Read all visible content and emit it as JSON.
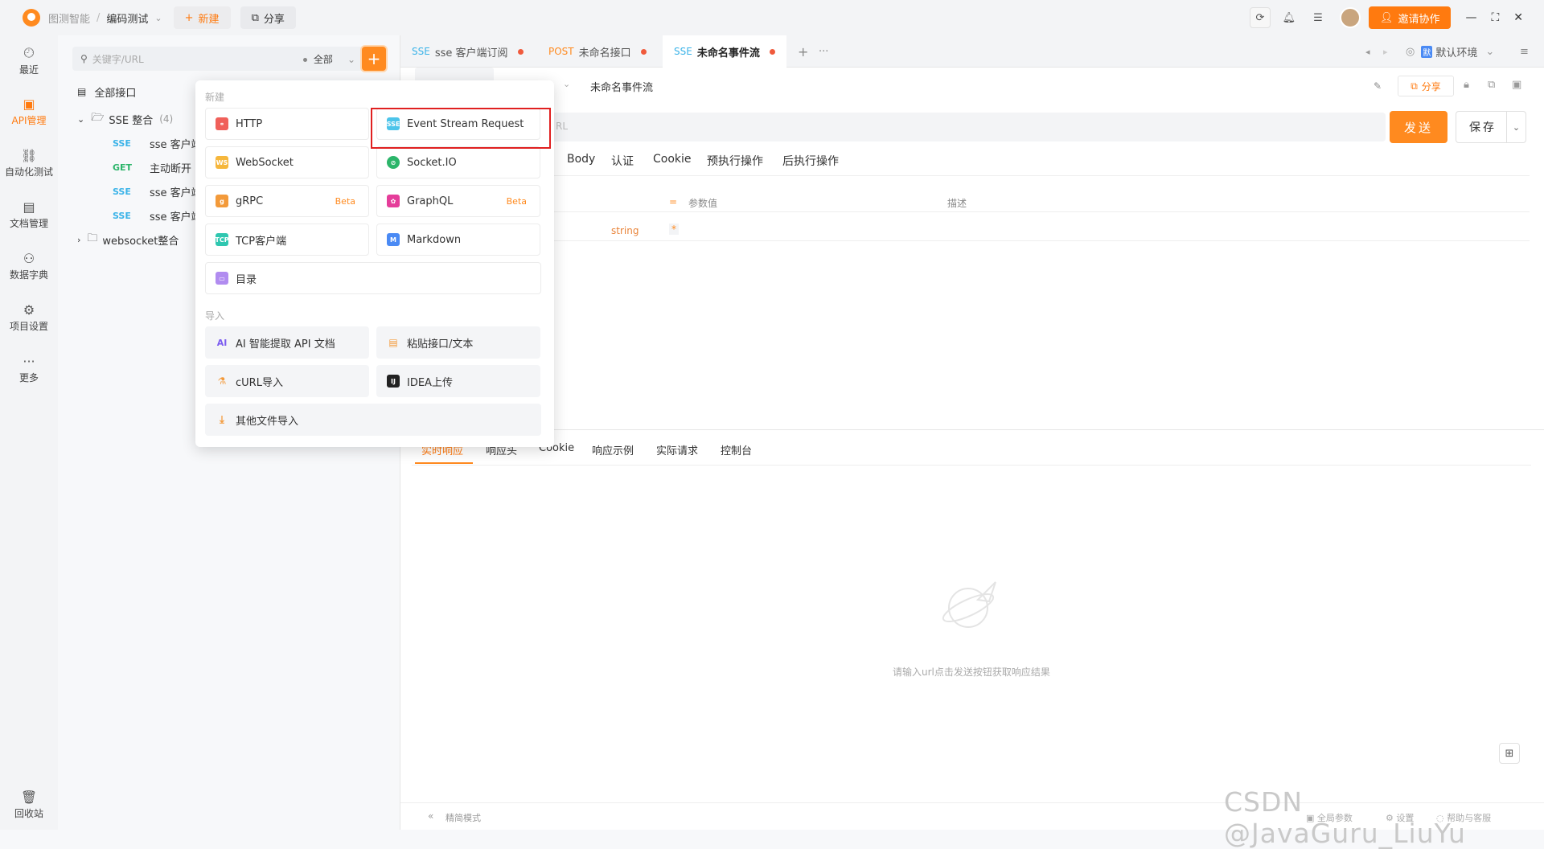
{
  "topbar": {
    "crumb_team": "图测智能",
    "crumb_sep": "/",
    "crumb_project": "编码测试",
    "new_label": "新建",
    "share_label": "分享",
    "invite_label": "邀请协作"
  },
  "nav": {
    "recent": "最近",
    "api": "API管理",
    "auto": "自动化测试",
    "docs": "文档管理",
    "dict": "数据字典",
    "settings": "项目设置",
    "more": "更多",
    "trash": "回收站"
  },
  "tree": {
    "search_placeholder": "关键字/URL",
    "filter": "全部",
    "all": "全部接口",
    "folder_sse": "SSE 整合",
    "folder_sse_count": "(4)",
    "items": [
      {
        "method": "SSE",
        "name": "sse 客户端"
      },
      {
        "method": "GET",
        "name": "主动断开"
      },
      {
        "method": "SSE",
        "name": "sse 客户端"
      },
      {
        "method": "SSE",
        "name": "sse 客户端"
      }
    ],
    "folder_ws": "websocket整合"
  },
  "tabs": [
    {
      "method": "SSE",
      "name": "sse 客户端订阅"
    },
    {
      "method": "POST",
      "name": "未命名接口"
    },
    {
      "method": "SSE",
      "name": "未命名事件流"
    }
  ],
  "tabs_extra": {
    "add": "+",
    "more": "···",
    "env": "默认环境",
    "env_badge": "默"
  },
  "main": {
    "title": "未命名事件流",
    "share": "分享",
    "url_placeholder": "RL",
    "send": "发送",
    "save": "保存",
    "req_tabs": [
      "Body",
      "认证",
      "Cookie",
      "预执行操作",
      "后执行操作"
    ],
    "param_value_header": "参数值",
    "desc_header": "描述",
    "type_string": "string",
    "required_mark": "*",
    "resp_tabs": [
      "实时响应",
      "响应头",
      "Cookie",
      "响应示例",
      "实际请求",
      "控制台"
    ],
    "empty_hint": "请输入url点击发送按钮获取响应结果",
    "compact_mode": "精简模式",
    "footer_global": "全局参数",
    "footer_settings": "设置",
    "footer_help": "帮助与客服"
  },
  "popup": {
    "section_new": "新建",
    "section_import": "导入",
    "new_items": [
      {
        "label": "HTTP",
        "icon": "http-icon",
        "color": "#f0605a"
      },
      {
        "label": "Event Stream Request",
        "icon": "sse-icon",
        "color": "#4cc4ea"
      },
      {
        "label": "WebSocket",
        "icon": "websocket-icon",
        "color": "#f6b73c"
      },
      {
        "label": "Socket.IO",
        "icon": "socketio-icon",
        "color": "#2cb56a"
      },
      {
        "label": "gRPC",
        "icon": "grpc-icon",
        "color": "#f39a3a",
        "beta": "Beta"
      },
      {
        "label": "GraphQL",
        "icon": "graphql-icon",
        "color": "#e53d9a",
        "beta": "Beta"
      },
      {
        "label": "TCP客户端",
        "icon": "tcp-icon",
        "color": "#2fc7b0"
      },
      {
        "label": "Markdown",
        "icon": "markdown-icon",
        "color": "#4a8af4"
      },
      {
        "label": "目录",
        "icon": "folder-icon",
        "color": "#b18cf0"
      }
    ],
    "import_items": [
      {
        "label": "AI 智能提取 API 文档",
        "icon": "ai-icon"
      },
      {
        "label": "粘贴接口/文本",
        "icon": "paste-icon"
      },
      {
        "label": "cURL导入",
        "icon": "curl-icon"
      },
      {
        "label": "IDEA上传",
        "icon": "idea-icon"
      },
      {
        "label": "其他文件导入",
        "icon": "download-icon"
      }
    ]
  },
  "watermark": "CSDN @JavaGuru_LiuYu"
}
